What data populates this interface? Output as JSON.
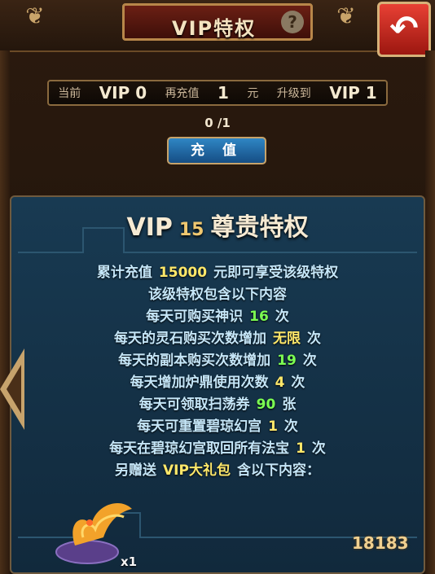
{
  "header": {
    "title": "VIP特权",
    "help_icon": "question-icon",
    "back_icon": "back-arrow-icon"
  },
  "status": {
    "current_label": "当前",
    "current_vip": "VIP 0",
    "recharge_label": "再充值",
    "recharge_amount": "1",
    "unit": "元",
    "upgrade_label": "升级到",
    "next_vip": "VIP 1"
  },
  "progress": {
    "text": "0 /1",
    "current": 0,
    "target": 1
  },
  "recharge_button": "充 值",
  "panel": {
    "heading_vip": "VIP",
    "heading_level": "15",
    "heading_title": "尊贵特权",
    "lines": [
      {
        "a": "累计充值",
        "v": "15000",
        "b": "元即可享受该级特权",
        "color": "yellow"
      },
      {
        "a": "该级特权包含以下内容",
        "v": "",
        "b": "",
        "color": ""
      },
      {
        "a": "每天可购买神识",
        "v": "16",
        "b": "次",
        "color": "green"
      },
      {
        "a": "每天的灵石购买次数增加",
        "v": "无限",
        "b": "次",
        "color": "yellow"
      },
      {
        "a": "每天的副本购买次数增加",
        "v": "19",
        "b": "次",
        "color": "green"
      },
      {
        "a": "每天增加炉鼎使用次数",
        "v": "4",
        "b": "次",
        "color": "yellow"
      },
      {
        "a": "每天可领取扫荡券",
        "v": "90",
        "b": "张",
        "color": "green"
      },
      {
        "a": "每天可重置碧琼幻宫",
        "v": "1",
        "b": "次",
        "color": "yellow"
      },
      {
        "a": "每天在碧琼幻宫取回所有法宝",
        "v": "1",
        "b": "次",
        "color": "yellow"
      },
      {
        "a": "另赠送",
        "v": "VIP大礼包",
        "b": "含以下内容：",
        "color": "yellow"
      }
    ]
  },
  "reward": {
    "icon": "phoenix-icon",
    "quantity": "x1"
  },
  "watermark": "18183",
  "colors": {
    "text_blue": "#c5e6f8",
    "yellow": "#ffe86a",
    "green": "#7cff52",
    "gold": "#c7a36c"
  }
}
